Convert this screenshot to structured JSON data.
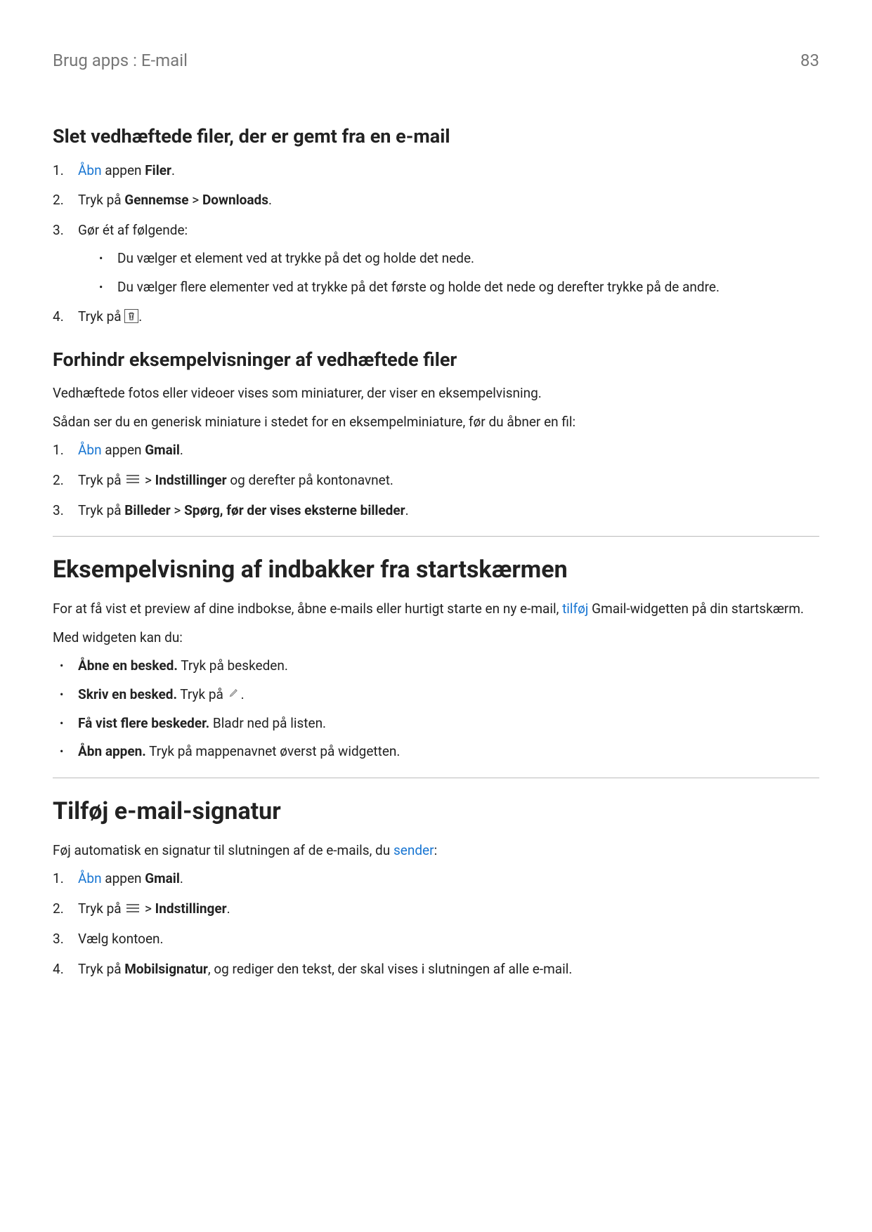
{
  "header": {
    "breadcrumb": "Brug apps : E-mail",
    "page_number": "83"
  },
  "section1": {
    "heading": "Slet vedhæftede filer, der er gemt fra en e-mail",
    "step1_pre": "Åbn",
    "step1_link": "Åbn",
    "step1_mid": " appen ",
    "step1_bold": "Filer",
    "step1_post": ".",
    "step2_pre": "Tryk på ",
    "step2_bold1": "Gennemse",
    "step2_gt": " > ",
    "step2_bold2": "Downloads",
    "step2_post": ".",
    "step3": "Gør ét af følgende:",
    "step3_a": "Du vælger et element ved at trykke på det og holde det nede.",
    "step3_b": "Du vælger flere elementer ved at trykke på det første og holde det nede og derefter trykke på de andre.",
    "step4_pre": "Tryk på ",
    "step4_post": "."
  },
  "section2": {
    "heading": "Forhindr eksempelvisninger af vedhæftede filer",
    "intro1": "Vedhæftede fotos eller videoer vises som miniaturer, der viser en eksempelvisning.",
    "intro2": "Sådan ser du en generisk miniature i stedet for en eksempelminiature, før du åbner en fil:",
    "step1_link": "Åbn",
    "step1_mid": " appen ",
    "step1_bold": "Gmail",
    "step1_post": ".",
    "step2_pre": "Tryk på ",
    "step2_gt": " > ",
    "step2_bold": "Indstillinger",
    "step2_post": " og derefter på kontonavnet.",
    "step3_pre": "Tryk på ",
    "step3_bold1": "Billeder",
    "step3_gt": " > ",
    "step3_bold2": "Spørg, før der vises eksterne billeder",
    "step3_post": "."
  },
  "section3": {
    "heading": "Eksempelvisning af indbakker fra startskærmen",
    "intro_pre": "For at få vist et preview af dine indbokse, åbne e-mails eller hurtigt starte en ny e-mail, ",
    "intro_link": "tilføj",
    "intro_post": " Gmail-widgetten på din startskærm.",
    "intro2": "Med widgeten kan du:",
    "b1_bold": "Åbne en besked.",
    "b1_post": " Tryk på beskeden.",
    "b2_bold": "Skriv en besked.",
    "b2_pre": " Tryk på ",
    "b2_post": ".",
    "b3_bold": "Få vist flere beskeder.",
    "b3_post": " Bladr ned på listen.",
    "b4_bold": "Åbn appen.",
    "b4_post": " Tryk på mappenavnet øverst på widgetten."
  },
  "section4": {
    "heading": "Tilføj e-mail-signatur",
    "intro_pre": "Føj automatisk en signatur til slutningen af de e-mails, du ",
    "intro_link": "sender",
    "intro_post": ":",
    "step1_link": "Åbn",
    "step1_mid": " appen ",
    "step1_bold": "Gmail",
    "step1_post": ".",
    "step2_pre": "Tryk på ",
    "step2_gt": " > ",
    "step2_bold": "Indstillinger",
    "step2_post": ".",
    "step3": "Vælg kontoen.",
    "step4_pre": "Tryk på ",
    "step4_bold": "Mobilsignatur",
    "step4_post": ", og rediger den tekst, der skal vises i slutningen af alle e-mail."
  }
}
